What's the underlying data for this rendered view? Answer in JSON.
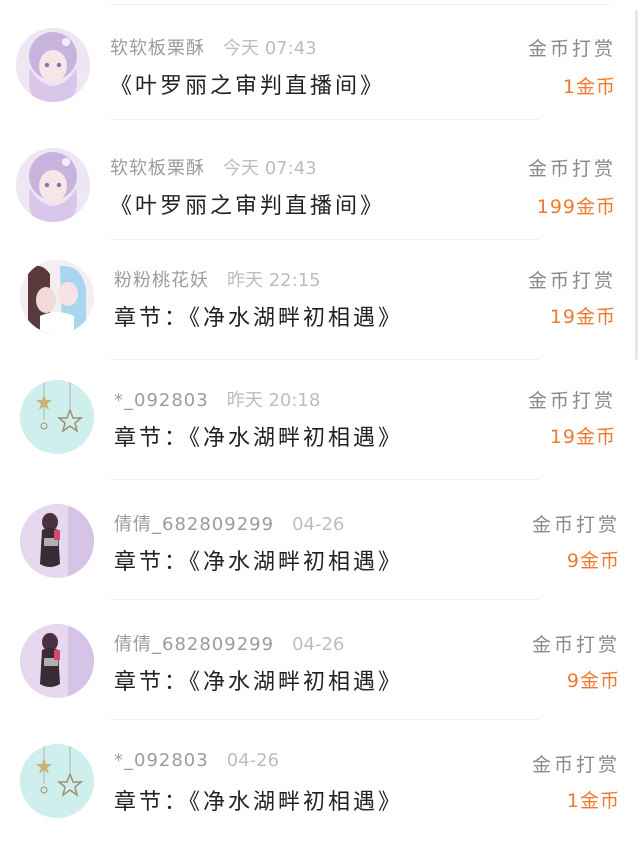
{
  "records": [
    {
      "user": "软软板栗酥",
      "time": "今天 07:43",
      "title": "《叶罗丽之审判直播间》",
      "type": "金币打赏",
      "amount": "1金币",
      "avatar": "anime-girl-avatar-lilac"
    },
    {
      "user": "软软板栗酥",
      "time": "今天 07:43",
      "title": "《叶罗丽之审判直播间》",
      "type": "金币打赏",
      "amount": "199金币",
      "avatar": "anime-girl-avatar-lilac"
    },
    {
      "user": "粉粉桃花妖",
      "time": "昨天 22:15",
      "title": "章节：《净水湖畔初相遇》",
      "type": "金币打赏",
      "amount": "19金币",
      "avatar": "anime-couple-avatar"
    },
    {
      "user": "*_092803",
      "time": "昨天 20:18",
      "title": "章节：《净水湖畔初相遇》",
      "type": "金币打赏",
      "amount": "19金币",
      "avatar": "star-ornament-avatar"
    },
    {
      "user": "倩倩_682809299",
      "time": "04-26",
      "title": "章节：《净水湖畔初相遇》",
      "type": "金币打赏",
      "amount": "9金币",
      "avatar": "girl-photo-avatar"
    },
    {
      "user": "倩倩_682809299",
      "time": "04-26",
      "title": "章节：《净水湖畔初相遇》",
      "type": "金币打赏",
      "amount": "9金币",
      "avatar": "girl-photo-avatar"
    },
    {
      "user": "*_092803",
      "time": "04-26",
      "title": "章节：《净水湖畔初相遇》",
      "type": "金币打赏",
      "amount": "1金币",
      "avatar": "star-ornament-avatar"
    }
  ],
  "colors": {
    "amount": "#ee7a2e",
    "type": "#8a8a8a",
    "user": "#9c9c9c",
    "time": "#bdbdbd",
    "title": "#222222"
  }
}
